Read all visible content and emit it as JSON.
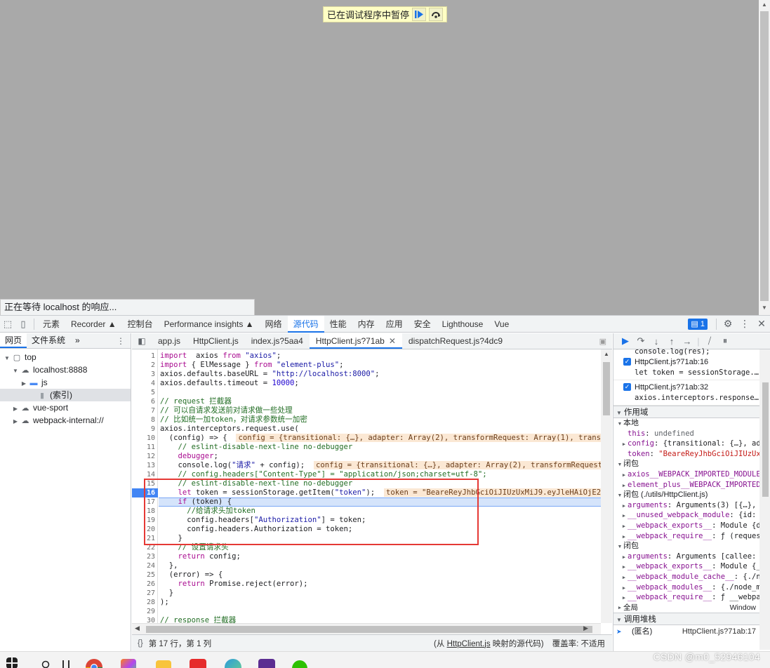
{
  "viewport": {
    "pause_banner_text": "已在调试程序中暂停",
    "waiting_text": "正在等待 localhost 的响应..."
  },
  "devtools_tabs": [
    "元素",
    "Recorder ▲",
    "控制台",
    "Performance insights ▲",
    "网络",
    "源代码",
    "性能",
    "内存",
    "应用",
    "安全",
    "Lighthouse",
    "Vue"
  ],
  "active_tab": "源代码",
  "issues_badge": "1",
  "navigator": {
    "tabs": [
      "网页",
      "文件系统"
    ],
    "more": "»",
    "tree": [
      {
        "label": "top",
        "depth": 0,
        "arrow": "▼",
        "icon": "frame-icon"
      },
      {
        "label": "localhost:8888",
        "depth": 1,
        "arrow": "▼",
        "icon": "cloud-icon"
      },
      {
        "label": "js",
        "depth": 2,
        "arrow": "▶",
        "icon": "folder-icon"
      },
      {
        "label": "(索引)",
        "depth": 3,
        "arrow": "",
        "icon": "file-icon",
        "selected": true
      },
      {
        "label": "vue-sport",
        "depth": 1,
        "arrow": "▶",
        "icon": "cloud-icon"
      },
      {
        "label": "webpack-internal://",
        "depth": 1,
        "arrow": "▶",
        "icon": "cloud-icon"
      }
    ]
  },
  "editor": {
    "tabs": [
      "app.js",
      "HttpClient.js",
      "index.js?5aa4",
      "HttpClient.js?71ab",
      "dispatchRequest.js?4dc9"
    ],
    "active_tab_index": 3,
    "breakpoint_line": 16,
    "current_line": 17,
    "lines": [
      {
        "n": 1,
        "parts": [
          [
            "kw",
            "import"
          ],
          [
            "",
            "  axios "
          ],
          [
            "kw",
            "from"
          ],
          [
            "",
            " "
          ],
          [
            "str",
            "\"axios\""
          ],
          [
            "",
            ";"
          ]
        ]
      },
      {
        "n": 2,
        "parts": [
          [
            "kw",
            "import"
          ],
          [
            "",
            " { ElMessage } "
          ],
          [
            "kw",
            "from"
          ],
          [
            "",
            " "
          ],
          [
            "str",
            "\"element-plus\""
          ],
          [
            "",
            ";"
          ]
        ]
      },
      {
        "n": 3,
        "parts": [
          [
            "",
            "axios.defaults.baseURL = "
          ],
          [
            "str",
            "\"http://localhost:8000\""
          ],
          [
            "",
            ";"
          ]
        ]
      },
      {
        "n": 4,
        "parts": [
          [
            "",
            "axios.defaults.timeout = "
          ],
          [
            "num",
            "10000"
          ],
          [
            "",
            ";"
          ]
        ]
      },
      {
        "n": 5,
        "parts": [
          [
            "",
            ""
          ]
        ]
      },
      {
        "n": 6,
        "parts": [
          [
            "cmt",
            "// request 拦截器"
          ]
        ]
      },
      {
        "n": 7,
        "parts": [
          [
            "cmt",
            "// 可以自请求发送前对请求做一些处理"
          ]
        ]
      },
      {
        "n": 8,
        "parts": [
          [
            "cmt",
            "// 比如统一加token，对请求参数统一加密"
          ]
        ]
      },
      {
        "n": 9,
        "parts": [
          [
            "",
            "axios.interceptors.request.use("
          ]
        ]
      },
      {
        "n": 10,
        "parts": [
          [
            "",
            "  (config) => {  "
          ],
          [
            "inlv",
            "config = {transitional: {…}, adapter: Array(2), transformRequest: Array(1), transformResp"
          ]
        ]
      },
      {
        "n": 11,
        "parts": [
          [
            "",
            "    "
          ],
          [
            "cmt",
            "// eslint-disable-next-line no-debugger"
          ]
        ]
      },
      {
        "n": 12,
        "parts": [
          [
            "",
            "    "
          ],
          [
            "kw",
            "debugger"
          ],
          [
            "",
            ";"
          ]
        ]
      },
      {
        "n": 13,
        "parts": [
          [
            "",
            "    console.log("
          ],
          [
            "str",
            "\"请求\""
          ],
          [
            "",
            " + config);  "
          ],
          [
            "inlv",
            "config = {transitional: {…}, adapter: Array(2), transformRequest: Array"
          ]
        ]
      },
      {
        "n": 14,
        "parts": [
          [
            "",
            "    "
          ],
          [
            "cmt",
            "// config.headers[\"Content-Type\"] = \"application/json;charset=utf-8\";"
          ]
        ]
      },
      {
        "n": 15,
        "parts": [
          [
            "",
            "    "
          ],
          [
            "cmt",
            "// eslint-disable-next-line no-debugger"
          ]
        ]
      },
      {
        "n": 16,
        "parts": [
          [
            "",
            "    "
          ],
          [
            "kw",
            "let"
          ],
          [
            "",
            " token = sessionStorage.getItem("
          ],
          [
            "str",
            "\"token\""
          ],
          [
            "",
            ");  "
          ],
          [
            "inlv",
            "token = \"BeareReyJhbGciOiJIUzUxMiJ9.eyJleHAiOjE2ODE5Mjc"
          ]
        ]
      },
      {
        "n": 17,
        "parts": [
          [
            "",
            "    "
          ],
          [
            "kw",
            "if"
          ],
          [
            "",
            " (token) {"
          ]
        ]
      },
      {
        "n": 18,
        "parts": [
          [
            "",
            "      "
          ],
          [
            "cmt",
            "//给请求头加token"
          ]
        ]
      },
      {
        "n": 19,
        "parts": [
          [
            "",
            "      config.headers["
          ],
          [
            "str",
            "\"Authorization\""
          ],
          [
            "",
            "] = token;"
          ]
        ]
      },
      {
        "n": 20,
        "parts": [
          [
            "",
            "      config.headers.Authorization = token;"
          ]
        ]
      },
      {
        "n": 21,
        "parts": [
          [
            "",
            "    }"
          ]
        ]
      },
      {
        "n": 22,
        "parts": [
          [
            "",
            "    "
          ],
          [
            "cmt",
            "// 设置请求头"
          ]
        ]
      },
      {
        "n": 23,
        "parts": [
          [
            "",
            "    "
          ],
          [
            "kw",
            "return"
          ],
          [
            "",
            " config;"
          ]
        ]
      },
      {
        "n": 24,
        "parts": [
          [
            "",
            "  },"
          ]
        ]
      },
      {
        "n": 25,
        "parts": [
          [
            "",
            "  (error) => {"
          ]
        ]
      },
      {
        "n": 26,
        "parts": [
          [
            "",
            "    "
          ],
          [
            "kw",
            "return"
          ],
          [
            "",
            " Promise.reject(error);"
          ]
        ]
      },
      {
        "n": 27,
        "parts": [
          [
            "",
            "  }"
          ]
        ]
      },
      {
        "n": 28,
        "parts": [
          [
            "",
            ");"
          ]
        ]
      },
      {
        "n": 29,
        "parts": [
          [
            "",
            ""
          ]
        ]
      },
      {
        "n": 30,
        "parts": [
          [
            "cmt",
            "// response 拦截器"
          ]
        ]
      }
    ]
  },
  "status_bar": {
    "position": "第 17 行，第 1 列",
    "source_prefix": "(从 ",
    "source_link": "HttpClient.js",
    "source_suffix": " 映射的源代码)",
    "coverage": "覆盖率: 不适用"
  },
  "debugger": {
    "top_snippet": "console.log(res);",
    "breakpoints": [
      {
        "location": "HttpClient.js?71ab:16",
        "code": "let token = sessionStorage.…"
      },
      {
        "location": "HttpClient.js?71ab:32",
        "code": "axios.interceptors.response…"
      }
    ],
    "scope_title": "作用域",
    "scopes": [
      {
        "title": "本地",
        "rows": [
          {
            "k": "this",
            "v": "undefined",
            "vt": "pvn",
            "arrow": ""
          },
          {
            "k": "config",
            "v": "{transitional: {…}, adap",
            "vt": "pv",
            "arrow": "▶"
          },
          {
            "k": "token",
            "v": "\"BeareReyJhbGciOiJIUzUxMi",
            "vt": "pvs",
            "arrow": ""
          }
        ]
      },
      {
        "title": "闭包",
        "rows": [
          {
            "k": "axios__WEBPACK_IMPORTED_MODULE_0",
            "v": "",
            "vt": "pv",
            "arrow": "▶"
          },
          {
            "k": "element_plus__WEBPACK_IMPORTED_M",
            "v": "",
            "vt": "pv",
            "arrow": "▶"
          }
        ]
      },
      {
        "title": "闭包 (./utils/HttpClient.js)",
        "rows": [
          {
            "k": "arguments",
            "v": "Arguments(3) [{…}, Mo",
            "vt": "pv",
            "arrow": "▶"
          },
          {
            "k": "__unused_webpack_module",
            "v": "{id: '",
            "vt": "pv",
            "arrow": "▶"
          },
          {
            "k": "__webpack_exports__",
            "v": "Module {def",
            "vt": "pv",
            "arrow": "▶"
          },
          {
            "k": "__webpack_require__",
            "v": "ƒ (request,",
            "vt": "pv",
            "arrow": "▶"
          }
        ]
      },
      {
        "title": "闭包",
        "rows": [
          {
            "k": "arguments",
            "v": "Arguments [callee: ƒ,",
            "vt": "pv",
            "arrow": "▶"
          },
          {
            "k": "__webpack_exports__",
            "v": "Module {__e",
            "vt": "pv",
            "arrow": "▶"
          },
          {
            "k": "__webpack_module_cache__",
            "v": "{./noc",
            "vt": "pv",
            "arrow": "▶"
          },
          {
            "k": "__webpack_modules__",
            "v": "{./node_mod",
            "vt": "pv",
            "arrow": "▶"
          },
          {
            "k": "__webpack_require__",
            "v": "ƒ __webpack",
            "vt": "pv",
            "arrow": "▶"
          }
        ]
      }
    ],
    "global_label": "全局",
    "global_value": "Window",
    "callstack_title": "调用堆栈",
    "frames": [
      {
        "name": "(匿名)",
        "loc": "HttpClient.js?71ab:17"
      }
    ]
  },
  "taskbar": {
    "watermark": "CSDN @m0_52946104"
  },
  "colors": {
    "accent": "#1a73e8",
    "red_box": "#e53935",
    "banner_bg": "#ffffc4"
  }
}
